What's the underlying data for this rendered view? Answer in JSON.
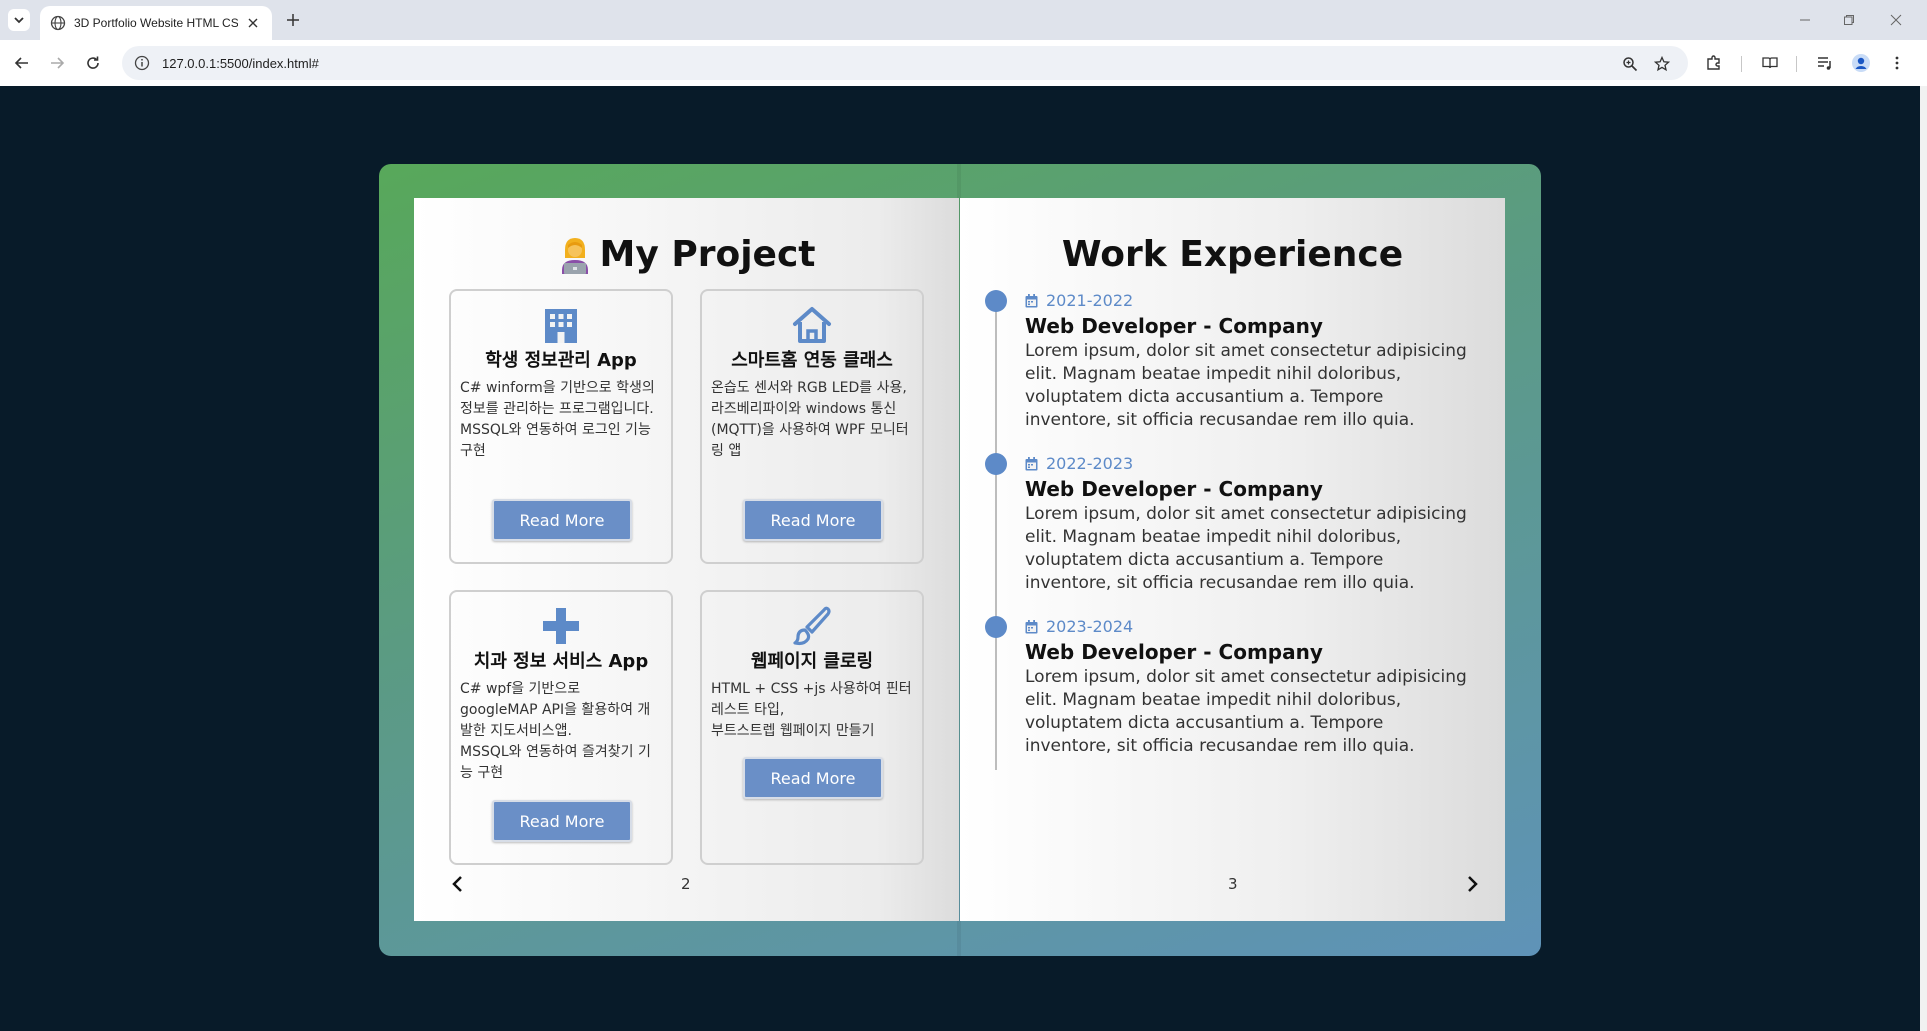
{
  "browser": {
    "tab_title": "3D Portfolio Website HTML CSS",
    "url": "127.0.0.1:5500/index.html#"
  },
  "left_page": {
    "title": "My Project",
    "page_number": "2",
    "projects": [
      {
        "icon": "building-icon",
        "title": "학생 정보관리 App",
        "desc": "C# winform을 기반으로 학생의 정보를 관리하는 프로그램입니다.\nMSSQL와 연동하여 로그인 기능 구현",
        "button": "Read More"
      },
      {
        "icon": "house-icon",
        "title": "스마트홈 연동 클래스",
        "desc": "온습도 센서와 RGB LED를 사용,\n라즈베리파이와 windows 통신(MQTT)을 사용하여 WPF 모니터링 앱",
        "button": "Read More"
      },
      {
        "icon": "plus-icon",
        "title": "치과 정보 서비스 App",
        "desc": "C# wpf을 기반으로 googleMAP API을 활용하여 개발한 지도서비스앱.\nMSSQL와 연동하여 즐겨찾기 기능 구현",
        "button": "Read More"
      },
      {
        "icon": "paintbrush-icon",
        "title": "웹페이지 클로링",
        "desc": "HTML + CSS +js 사용하여 핀터레스트 타입,\n부트스트렙 웹페이지 만들기",
        "button": "Read More"
      }
    ]
  },
  "right_page": {
    "title": "Work Experience",
    "page_number": "3",
    "experience": [
      {
        "date": "2021-2022",
        "role": "Web Developer - Company",
        "text": "Lorem ipsum, dolor sit amet consectetur adipisicing elit. Magnam beatae impedit nihil doloribus, voluptatem dicta accusantium a. Tempore inventore, sit officia recusandae rem illo quia."
      },
      {
        "date": "2022-2023",
        "role": "Web Developer - Company",
        "text": "Lorem ipsum, dolor sit amet consectetur adipisicing elit. Magnam beatae impedit nihil doloribus, voluptatem dicta accusantium a. Tempore inventore, sit officia recusandae rem illo quia."
      },
      {
        "date": "2023-2024",
        "role": "Web Developer - Company",
        "text": "Lorem ipsum, dolor sit amet consectetur adipisicing elit. Magnam beatae impedit nihil doloribus, voluptatem dicta accusantium a. Tempore inventore, sit officia recusandae rem illo quia."
      }
    ]
  },
  "colors": {
    "accent": "#5d8ac8",
    "button": "#6a8fc7",
    "page_background": "#081b29",
    "book_gradient_start": "#58a85a",
    "book_gradient_end": "#5f93b8"
  }
}
